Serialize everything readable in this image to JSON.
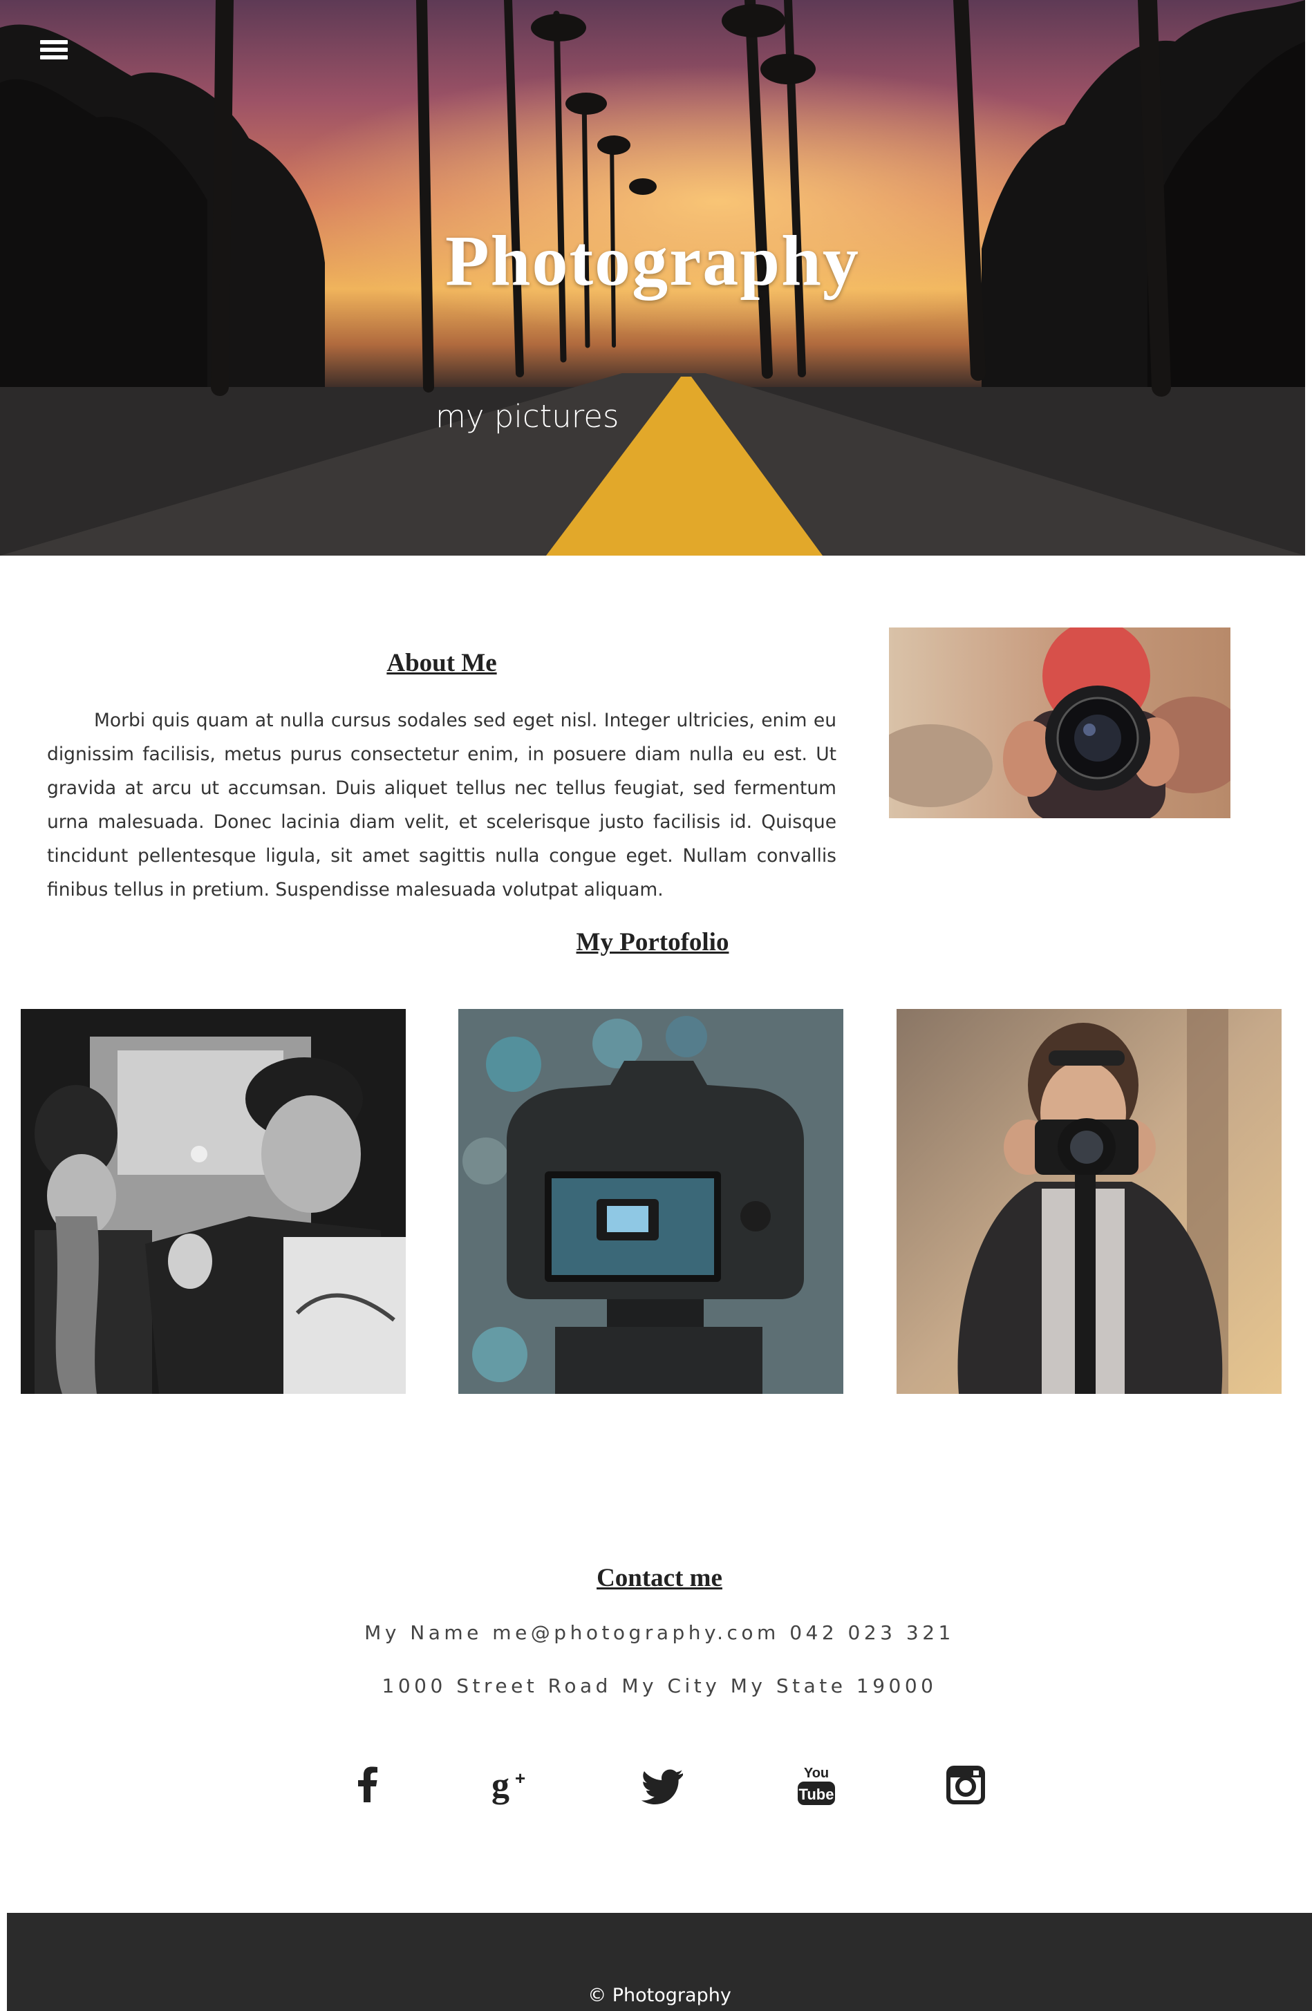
{
  "hero": {
    "title": "Photography",
    "subtitle": "my pictures",
    "menu_icon": "hamburger-menu-icon"
  },
  "about": {
    "title": "About Me",
    "text": "Morbi quis quam at nulla cursus sodales sed eget nisl. Integer ultricies, enim eu dignissim facilisis, metus purus consectetur enim, in posuere diam nulla eu est. Ut gravida at arcu ut accumsan. Duis aliquet tellus nec tellus feugiat, sed fermentum urna malesuada. Donec lacinia diam velit, et scelerisque justo facilisis id. Quisque tincidunt pellentesque ligula, sit amet sagittis nulla congue eget. Nullam convallis finibus tellus in pretium. Suspendisse malesuada volutpat aliquam."
  },
  "portfolio": {
    "title": "My Portofolio"
  },
  "contact": {
    "title": "Contact me",
    "line1": "My Name me@photography.com 042 023 321",
    "line2": "1000 Street Road My City My State 19000",
    "social_icons": [
      "facebook-icon",
      "google-plus-icon",
      "twitter-icon",
      "youtube-icon",
      "instagram-icon"
    ]
  },
  "footer": {
    "text": "© Photography",
    "background": "#2b2b2b"
  }
}
